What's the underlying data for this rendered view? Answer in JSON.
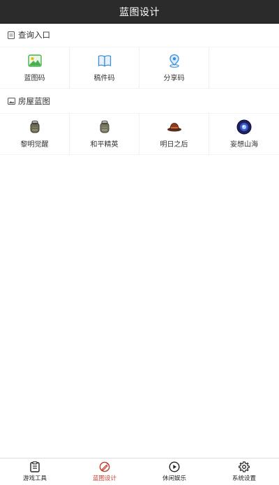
{
  "header": {
    "title": "蓝图设计"
  },
  "query_section": {
    "title": "查询入口",
    "items": [
      {
        "label": "蓝图码",
        "icon": "image-icon"
      },
      {
        "label": "稿件码",
        "icon": "book-icon"
      },
      {
        "label": "分享码",
        "icon": "location-pin-icon"
      }
    ]
  },
  "house_section": {
    "title": "房屋蓝图",
    "items": [
      {
        "label": "黎明觉醒",
        "icon": "backpack-icon"
      },
      {
        "label": "和平精英",
        "icon": "backpack-icon"
      },
      {
        "label": "明日之后",
        "icon": "hat-icon"
      },
      {
        "label": "妄想山海",
        "icon": "orb-icon"
      }
    ]
  },
  "tabbar": {
    "tabs": [
      {
        "label": "游戏工具",
        "icon": "clipboard-icon",
        "active": false
      },
      {
        "label": "蓝图设计",
        "icon": "design-icon",
        "active": true
      },
      {
        "label": "休闲娱乐",
        "icon": "play-icon",
        "active": false
      },
      {
        "label": "系统设置",
        "icon": "gear-icon",
        "active": false
      }
    ]
  },
  "colors": {
    "header_bg": "#2b2b2b",
    "active_tab": "#c0392b",
    "pin_blue": "#3a8fd9",
    "image_green": "#4caf50"
  }
}
